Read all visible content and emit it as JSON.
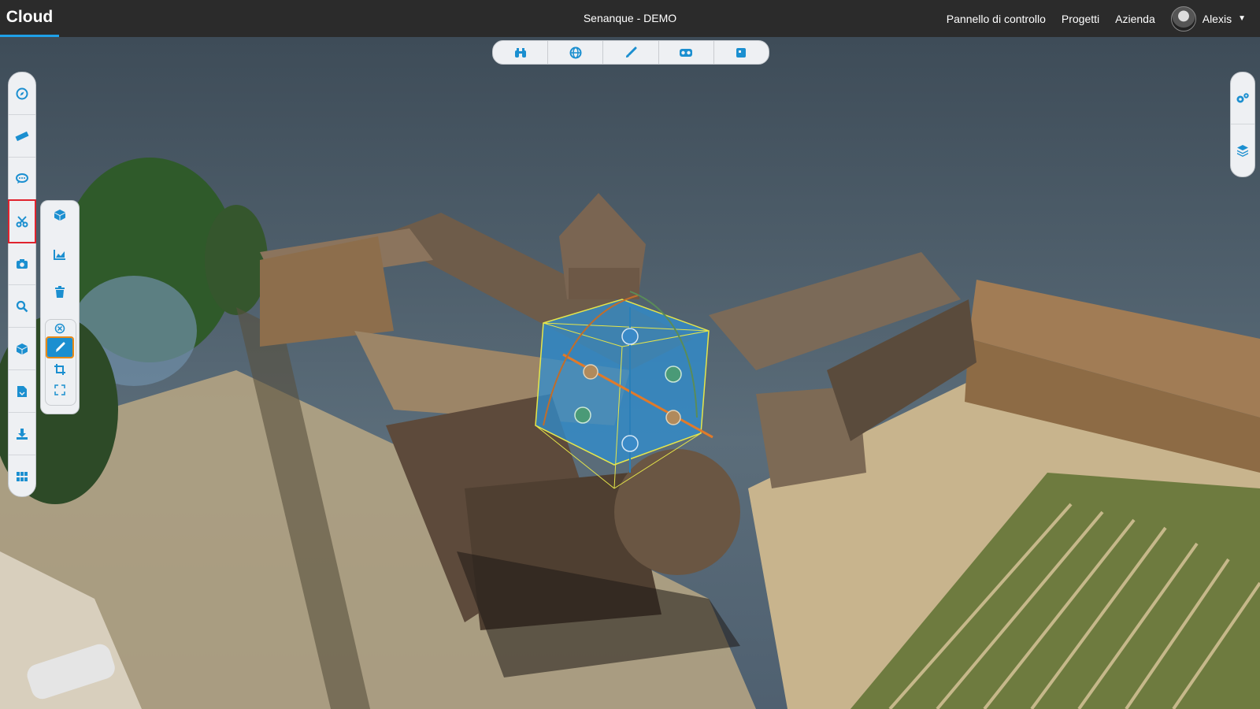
{
  "app": {
    "brand": "Cloud",
    "project_title": "Senanque - DEMO"
  },
  "nav": {
    "dashboard": "Pannello di controllo",
    "projects": "Progetti",
    "company": "Azienda",
    "user_name": "Alexis"
  },
  "view_toolbar": {
    "icons": [
      "binoculars-icon",
      "globe-icon",
      "brush-icon",
      "vr-headset-icon",
      "cube-face-icon"
    ]
  },
  "left_toolbar": {
    "icons": [
      "compass-icon",
      "ruler-icon",
      "comment-icon",
      "scissors-icon",
      "camera-icon",
      "search-icon",
      "cube-icon",
      "file-export-icon",
      "download-icon",
      "grid-icon"
    ],
    "active": "scissors-icon"
  },
  "clip_panel": {
    "icons": [
      "box-clip-icon",
      "profile-chart-icon",
      "trash-icon",
      "remove-circle-icon",
      "pencil-icon",
      "crop-icon",
      "expand-icon"
    ],
    "active": "pencil-icon"
  },
  "right_toolbar": {
    "icons": [
      "settings-icon",
      "layers-icon"
    ]
  },
  "colors": {
    "accent": "#1b8fd0",
    "active_border": "#e0232e",
    "selected_tool": "#e88a18",
    "topbar": "#2b2b2b"
  }
}
